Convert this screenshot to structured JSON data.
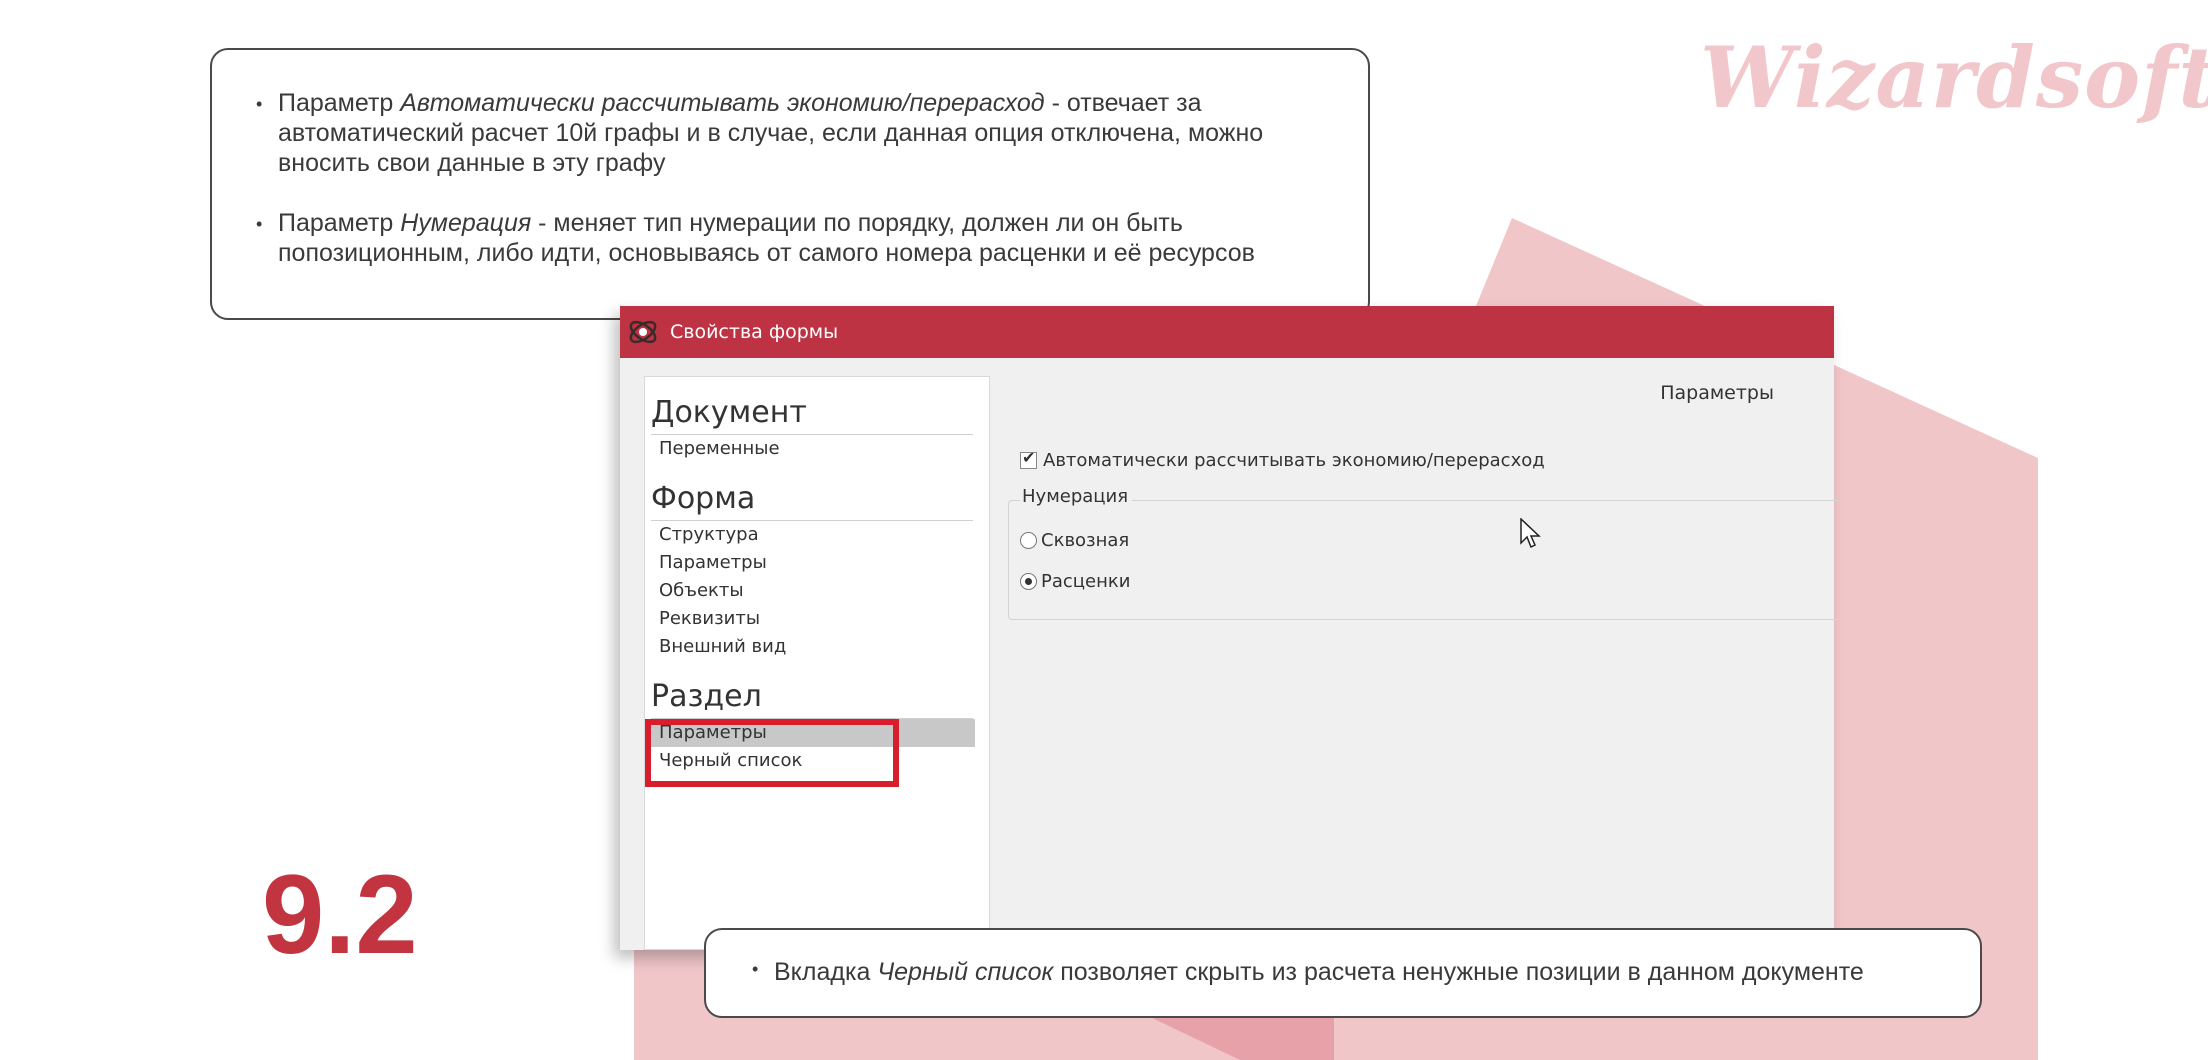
{
  "brand": {
    "logo_text": "Wizardsoft",
    "accent_color": "#bd3344",
    "background_shape_color": "#f0c6c9"
  },
  "slide": {
    "number": "9.2",
    "top_note": {
      "bullet1_prefix": "Параметр ",
      "bullet1_term": "Автоматически рассчитывать экономию/перерасход",
      "bullet1_rest": " - отвечает за автоматический расчет 10й графы и в случае, если данная опция отключена, можно вносить свои данные в эту графу",
      "bullet2_prefix": "Параметр ",
      "bullet2_term": "Нумерация",
      "bullet2_rest": " - меняет тип нумерации по порядку, должен ли он быть попозиционным, либо идти, основываясь от самого номера расценки и её ресурсов"
    },
    "bottom_note": {
      "prefix": "Вкладка ",
      "term": "Черный список",
      "rest": " позволяет скрыть из расчета ненужные позиции в данном документе"
    }
  },
  "dialog": {
    "title": "Свойства формы",
    "nav": {
      "document_heading": "Документ",
      "document_items": [
        "Переменные"
      ],
      "form_heading": "Форма",
      "form_items": [
        "Структура",
        "Параметры",
        "Объекты",
        "Реквизиты",
        "Внешний вид"
      ],
      "section_heading": "Раздел",
      "section_items": [
        "Параметры",
        "Черный список"
      ],
      "selected": "Параметры"
    },
    "content": {
      "title": "Параметры",
      "auto_calc_label": "Автоматически рассчитывать экономию/перерасход",
      "auto_calc_checked": true,
      "numbering_label": "Нумерация",
      "numbering_options": [
        "Сквозная",
        "Расценки"
      ],
      "numbering_selected": "Расценки"
    }
  }
}
